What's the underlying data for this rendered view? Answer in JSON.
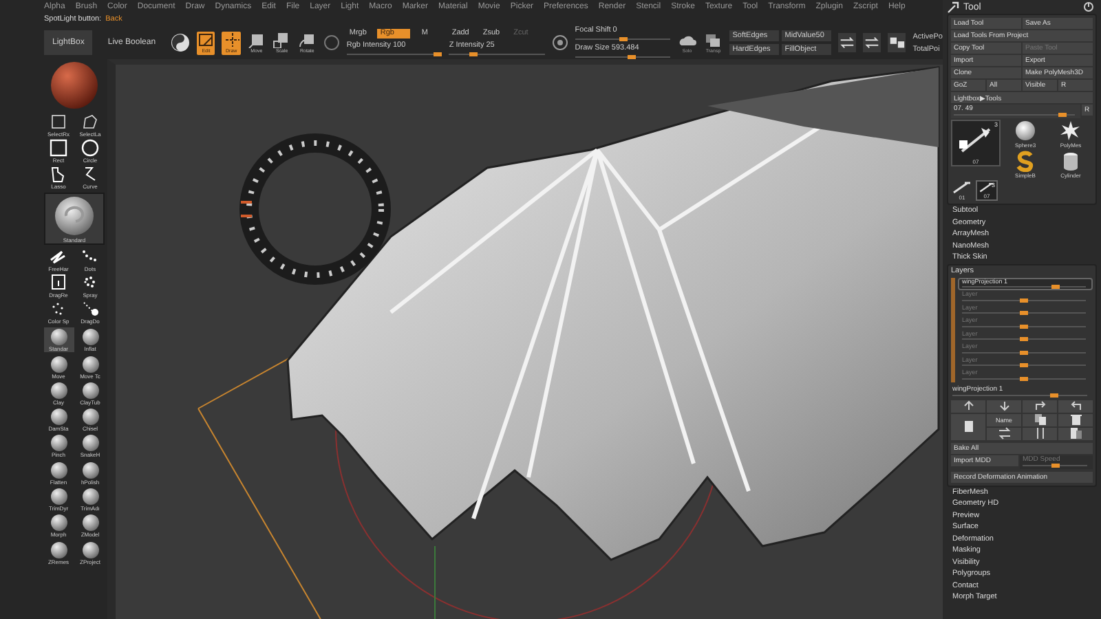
{
  "menu_bar": {
    "items": [
      "Alpha",
      "Brush",
      "Color",
      "Document",
      "Draw",
      "Dynamics",
      "Edit",
      "File",
      "Layer",
      "Light",
      "Macro",
      "Marker",
      "Material",
      "Movie",
      "Picker",
      "Preferences",
      "Render",
      "Stencil",
      "Stroke",
      "Texture",
      "Tool",
      "Transform",
      "Zplugin",
      "Zscript",
      "Help"
    ]
  },
  "info_line": {
    "label": "SpotLight button:",
    "value": "Back"
  },
  "toolbar": {
    "text_buttons": [
      {
        "label": "LightBox",
        "highlighted": true
      },
      {
        "label": "Live Boolean",
        "highlighted": false
      }
    ],
    "transform_buttons": [
      {
        "kind": "edit",
        "label": "Edit",
        "selected": true
      },
      {
        "kind": "draw",
        "label": "Draw",
        "selected": true
      },
      {
        "kind": "move",
        "label": "Move",
        "selected": false
      },
      {
        "kind": "scale",
        "label": "Scale",
        "selected": false
      },
      {
        "kind": "rotate",
        "label": "Rotate",
        "selected": false
      }
    ],
    "color_group": {
      "modes": [
        {
          "label": "Mrgb",
          "selected": false
        },
        {
          "label": "Rgb",
          "selected": true
        },
        {
          "label": "M",
          "selected": false
        }
      ],
      "slider": {
        "label": "Rgb Intensity",
        "value": "100",
        "level": 0.95
      }
    },
    "z_group": {
      "modes": [
        {
          "label": "Zadd",
          "disabled": false
        },
        {
          "label": "Zsub",
          "disabled": false
        },
        {
          "label": "Zcut",
          "disabled": true
        }
      ],
      "slider": {
        "label": "Z Intensity",
        "value": "25",
        "level": 0.25
      }
    },
    "brush_sliders": [
      {
        "label": "Focal Shift",
        "value": "0",
        "level": 0.5
      },
      {
        "label": "Draw Size",
        "value": "593.484",
        "level": 0.6
      }
    ],
    "view_buttons": [
      {
        "kind": "cloud",
        "label": "Solo"
      },
      {
        "kind": "layers",
        "label": "Transp"
      }
    ],
    "edge_buttons": [
      "SoftEdges",
      "MidValue50",
      "HardEdges",
      "FillObject"
    ],
    "stats": [
      "ActivePo",
      "TotalPoi"
    ]
  },
  "left_palette": {
    "selection_tools": [
      {
        "kind": "select-rect",
        "label": "SelectRx"
      },
      {
        "kind": "select-lasso",
        "label": "SelectLa"
      },
      {
        "kind": "rect",
        "label": "Rect"
      },
      {
        "kind": "circle",
        "label": "Circle"
      },
      {
        "kind": "lasso",
        "label": "Lasso"
      },
      {
        "kind": "curve",
        "label": "Curve"
      }
    ],
    "current_brush": {
      "label": "Standard"
    },
    "strokes": [
      {
        "kind": "freehand",
        "label": "FreeHar"
      },
      {
        "kind": "dots",
        "label": "Dots"
      },
      {
        "kind": "dragrect",
        "label": "DragRe"
      },
      {
        "kind": "spray",
        "label": "Spray"
      },
      {
        "kind": "colorspray",
        "label": "Color Sp"
      },
      {
        "kind": "dragdot",
        "label": "DragDo"
      }
    ],
    "brushes": [
      {
        "label": "Standar",
        "selected": true
      },
      {
        "label": "Inflat",
        "selected": false
      },
      {
        "label": "Move",
        "selected": false
      },
      {
        "label": "Move Tc",
        "selected": false
      },
      {
        "label": "Clay",
        "selected": false
      },
      {
        "label": "ClayTub",
        "selected": false
      },
      {
        "label": "DamSta",
        "selected": false
      },
      {
        "label": "Chisel",
        "selected": false
      },
      {
        "label": "Pinch",
        "selected": false
      },
      {
        "label": "SnakeH",
        "selected": false
      },
      {
        "label": "Flatten",
        "selected": false
      },
      {
        "label": "hPolish",
        "selected": false
      },
      {
        "label": "TrimDyr",
        "selected": false
      },
      {
        "label": "TrimAdı",
        "selected": false
      },
      {
        "label": "Morph",
        "selected": false
      },
      {
        "label": "ZModel",
        "selected": false
      },
      {
        "label": "ZRemes",
        "selected": false
      },
      {
        "label": "ZProject",
        "selected": false
      }
    ]
  },
  "tool_panel": {
    "title": "Tool",
    "button_rows": [
      [
        {
          "label": "Load Tool",
          "disabled": false
        },
        {
          "label": "Save As",
          "disabled": false
        }
      ],
      [
        {
          "label": "Load Tools From Project",
          "disabled": false
        }
      ],
      [
        {
          "label": "Copy Tool",
          "disabled": false
        },
        {
          "label": "Paste Tool",
          "disabled": true
        }
      ],
      [
        {
          "label": "Import",
          "disabled": false
        },
        {
          "label": "Export",
          "disabled": false
        }
      ],
      [
        {
          "label": "Clone",
          "disabled": false
        },
        {
          "label": "Make PolyMesh3D",
          "disabled": false
        }
      ],
      [
        {
          "label": "GoZ",
          "disabled": false
        },
        {
          "label": "All",
          "disabled": false
        },
        {
          "label": "Visible",
          "disabled": false
        },
        {
          "label": "R",
          "disabled": false
        }
      ],
      [
        {
          "label": "Lightbox▶Tools",
          "disabled": false
        }
      ]
    ],
    "tool_slider": {
      "value": "07. 49",
      "level": 0.9,
      "reset": "R"
    },
    "current_tool": {
      "label": "07",
      "count": "3"
    },
    "tools": [
      {
        "kind": "sphere",
        "label": "Sphere3"
      },
      {
        "kind": "star",
        "label": "PolyMes"
      },
      {
        "kind": "s-shape",
        "label": "SimpleB"
      },
      {
        "kind": "cylinder",
        "label": "Cylinder"
      }
    ],
    "subtools": [
      {
        "label": "01",
        "selected": false
      },
      {
        "label": "07",
        "count": "3",
        "selected": true
      }
    ],
    "sections": [
      "Subtool",
      "Geometry",
      "ArrayMesh",
      "NanoMesh",
      "Thick Skin"
    ],
    "layers": {
      "title": "Layers",
      "items": [
        {
          "name": "wingProjection 1",
          "active": true,
          "level": 0.75
        },
        {
          "name": "Layer",
          "active": false,
          "level": 0.5
        },
        {
          "name": "Layer",
          "active": false,
          "level": 0.5
        },
        {
          "name": "Layer",
          "active": false,
          "level": 0.5
        },
        {
          "name": "Layer",
          "active": false,
          "level": 0.5
        },
        {
          "name": "Layer",
          "active": false,
          "level": 0.5
        },
        {
          "name": "Layer",
          "active": false,
          "level": 0.5
        },
        {
          "name": "Layer",
          "active": false,
          "level": 0.5
        }
      ],
      "projection": {
        "label": "wingProjection 1",
        "level": 0.75
      },
      "tools": [
        {
          "kind": "up"
        },
        {
          "kind": "down"
        },
        {
          "kind": "redo"
        },
        {
          "kind": "undo"
        },
        {
          "kind": "page"
        },
        {
          "kind": "name",
          "label": "Name"
        },
        {
          "kind": "copy"
        },
        {
          "kind": "trash"
        },
        {
          "kind": "swap"
        },
        {
          "kind": "sort"
        },
        {
          "kind": "split"
        }
      ],
      "bake": "Bake All",
      "import": "Import MDD",
      "speed": {
        "label": "MDD Speed",
        "disabled": true,
        "level": 0.5
      },
      "record": "Record Deformation Animation"
    },
    "sections_after": [
      "FiberMesh",
      "Geometry HD",
      "Preview",
      "Surface",
      "Deformation",
      "Masking",
      "Visibility",
      "Polygroups",
      "Contact",
      "Morph Target"
    ]
  }
}
